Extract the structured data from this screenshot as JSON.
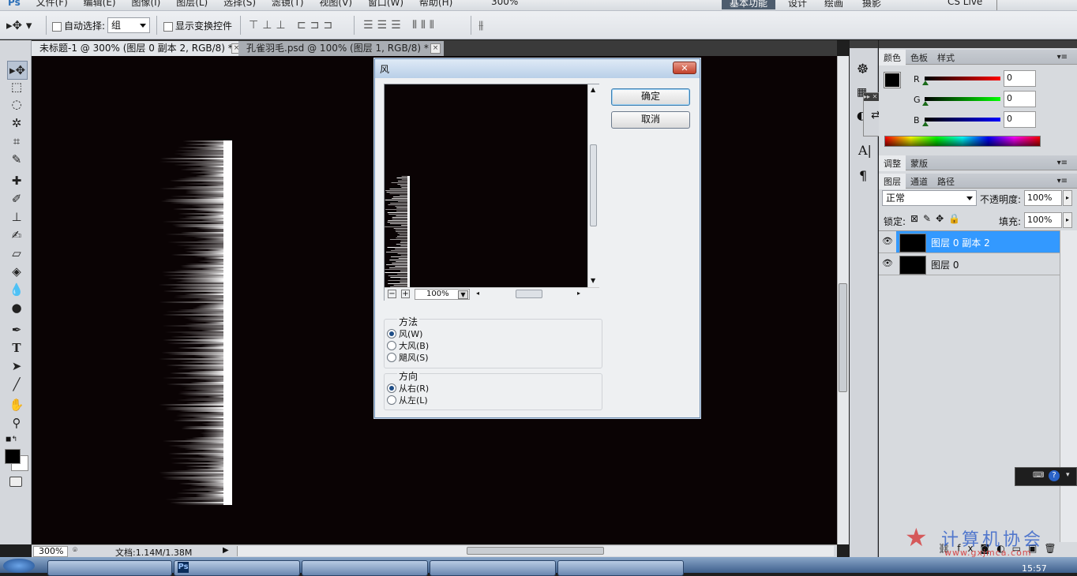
{
  "app": {
    "menus": [
      "文件(F)",
      "编辑(E)",
      "图像(I)",
      "图层(L)",
      "选择(S)",
      "滤镜(T)",
      "视图(V)",
      "窗口(W)",
      "帮助(H)"
    ],
    "zoom_top": "300%",
    "workspaces": [
      "基本功能",
      "设计",
      "绘画",
      "摄影"
    ],
    "cs_live": "CS Live"
  },
  "options_bar": {
    "auto_select_label": "自动选择:",
    "auto_select_value": "组",
    "show_transform_label": "显示变换控件"
  },
  "tabs": [
    {
      "label": "未标题-1 @ 300% (图层 0 副本 2, RGB/8) *",
      "active": true
    },
    {
      "label": "孔雀羽毛.psd @ 100% (图层 1, RGB/8) *",
      "active": false
    }
  ],
  "status": {
    "zoom": "300%",
    "doc": "文档:1.14M/1.38M"
  },
  "dialog": {
    "title": "风",
    "ok": "确定",
    "cancel": "取消",
    "zoom": "100%",
    "method_label": "方法",
    "methods": [
      {
        "label": "风(W)",
        "selected": true
      },
      {
        "label": "大风(B)",
        "selected": false
      },
      {
        "label": "飓风(S)",
        "selected": false
      }
    ],
    "direction_label": "方向",
    "directions": [
      {
        "label": "从右(R)",
        "selected": true
      },
      {
        "label": "从左(L)",
        "selected": false
      }
    ]
  },
  "panels": {
    "color_tabs": [
      "颜色",
      "色板",
      "样式"
    ],
    "r_label": "R",
    "g_label": "G",
    "b_label": "B",
    "r_value": "0",
    "g_value": "0",
    "b_value": "0",
    "adjust_tabs": [
      "调整",
      "蒙版"
    ],
    "layer_tabs": [
      "图层",
      "通道",
      "路径"
    ],
    "blend_mode": "正常",
    "opacity_label": "不透明度:",
    "opacity_value": "100%",
    "lock_label": "锁定:",
    "fill_label": "填充:",
    "fill_value": "100%",
    "layers": [
      {
        "name": "图层 0 副本 2",
        "selected": true
      },
      {
        "name": "图层 0",
        "selected": false
      }
    ]
  },
  "taskbar": {
    "clock": "15:57"
  },
  "watermark": {
    "text": "计算机协会",
    "url": "www.gxjmca.com"
  },
  "colors": {
    "canvas": "#0a0304",
    "selected_layer": "#3399ff",
    "dialog_border": "#6f8fb4"
  }
}
